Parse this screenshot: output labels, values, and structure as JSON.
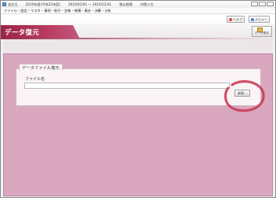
{
  "titlebar": {
    "app_name": "会計王",
    "period": "2010年度(平成22年度)",
    "date_range": "2010/01/01 ～ 2010/12/31",
    "mode": "税込経理",
    "input": "内税入力"
  },
  "menu": {
    "items": [
      "ファイル",
      "設定",
      "マスタ",
      "事例",
      "取引",
      "台帳",
      "帳簿",
      "集計",
      "決算",
      "分析"
    ]
  },
  "toolbar": {
    "help_label": "ヘルプ",
    "menu_label": "メニュー"
  },
  "header": {
    "title": "データ復元",
    "restore_button_label": "データ復元",
    "accent_color": "#9a2448"
  },
  "form": {
    "group_title": "データファイル復元",
    "file_name_label": "ファイル名",
    "file_name_value": "",
    "browse_button_label": "参照..."
  },
  "colors": {
    "content_bg": "#d9a8bf",
    "highlight_ring": "#c9344f"
  }
}
